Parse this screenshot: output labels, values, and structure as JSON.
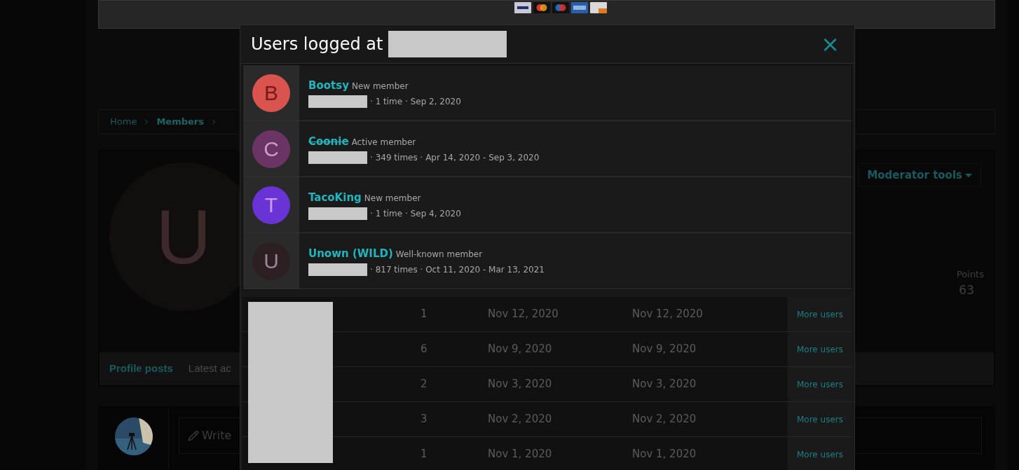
{
  "breadcrumb": [
    {
      "label": "Home",
      "current": false
    },
    {
      "label": "Members",
      "current": true
    }
  ],
  "profile": {
    "avatar_letter": "U",
    "moderator_button": "Moderator tools",
    "stat_label": "Points",
    "stat_value": "63"
  },
  "profile_tabs": [
    {
      "label": "Profile posts",
      "selected": true
    },
    {
      "label": "Latest ac",
      "selected": false
    }
  ],
  "post_box": {
    "placeholder": "Write"
  },
  "dialog": {
    "title": "Users logged at",
    "close": "×",
    "users": [
      {
        "letter": "B",
        "color": "#d9534f",
        "name": "Bootsy",
        "banned": false,
        "title": "New member",
        "detail": "· 1 time · Sep 2, 2020"
      },
      {
        "letter": "C",
        "color": "#6b3465",
        "name": "Coonie",
        "banned": true,
        "title": "Active member",
        "detail": "· 349 times · Apr 14, 2020 - Sep 3, 2020"
      },
      {
        "letter": "T",
        "color": "#6a33d6",
        "name": "TacoKing",
        "banned": false,
        "title": "New member",
        "detail": "· 1 time · Sep 4, 2020"
      },
      {
        "letter": "U",
        "color": "#2b1f1f",
        "name": "Unown (WILD)",
        "banned": false,
        "title": "Well-known member",
        "detail": "· 817 times · Oct 11, 2020 - Mar 13, 2021"
      }
    ],
    "rows": [
      {
        "count": "1",
        "first": "Nov 12, 2020",
        "last": "Nov 12, 2020",
        "link": "More users"
      },
      {
        "count": "6",
        "first": "Nov 9, 2020",
        "last": "Nov 9, 2020",
        "link": "More users"
      },
      {
        "count": "2",
        "first": "Nov 3, 2020",
        "last": "Nov 3, 2020",
        "link": "More users"
      },
      {
        "count": "3",
        "first": "Nov 2, 2020",
        "last": "Nov 2, 2020",
        "link": "More users"
      },
      {
        "count": "1",
        "first": "Nov 1, 2020",
        "last": "Nov 1, 2020",
        "link": "More users"
      }
    ]
  }
}
